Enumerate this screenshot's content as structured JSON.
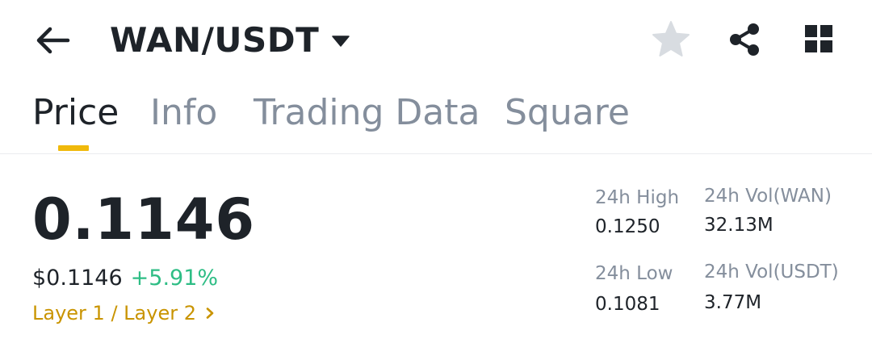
{
  "header": {
    "pair": "WAN/USDT",
    "icons": {
      "back": "back-arrow-icon",
      "dropdown": "caret-down-icon",
      "favorite": "star-icon",
      "share": "share-icon",
      "more": "grid-icon"
    }
  },
  "tabs": [
    {
      "label": "Price",
      "active": true
    },
    {
      "label": "Info",
      "active": false
    },
    {
      "label": "Trading Data",
      "active": false
    },
    {
      "label": "Square",
      "active": false
    }
  ],
  "ticker": {
    "last_price": "0.1146",
    "usd_price": "$0.1146",
    "change_pct": "+5.91%",
    "tags": "Layer 1 / Layer 2"
  },
  "stats": {
    "high_label": "24h High",
    "high_value": "0.1250",
    "low_label": "24h Low",
    "low_value": "0.1081",
    "vol_base_label": "24h Vol(WAN)",
    "vol_base_value": "32.13M",
    "vol_quote_label": "24h Vol(USDT)",
    "vol_quote_value": "3.77M"
  },
  "colors": {
    "text_primary": "#1e2329",
    "text_secondary": "#848e9c",
    "accent_yellow": "#f0b90b",
    "tag_gold": "#c99400",
    "positive_green": "#2ebd85",
    "star_gray": "#d8dce1"
  }
}
